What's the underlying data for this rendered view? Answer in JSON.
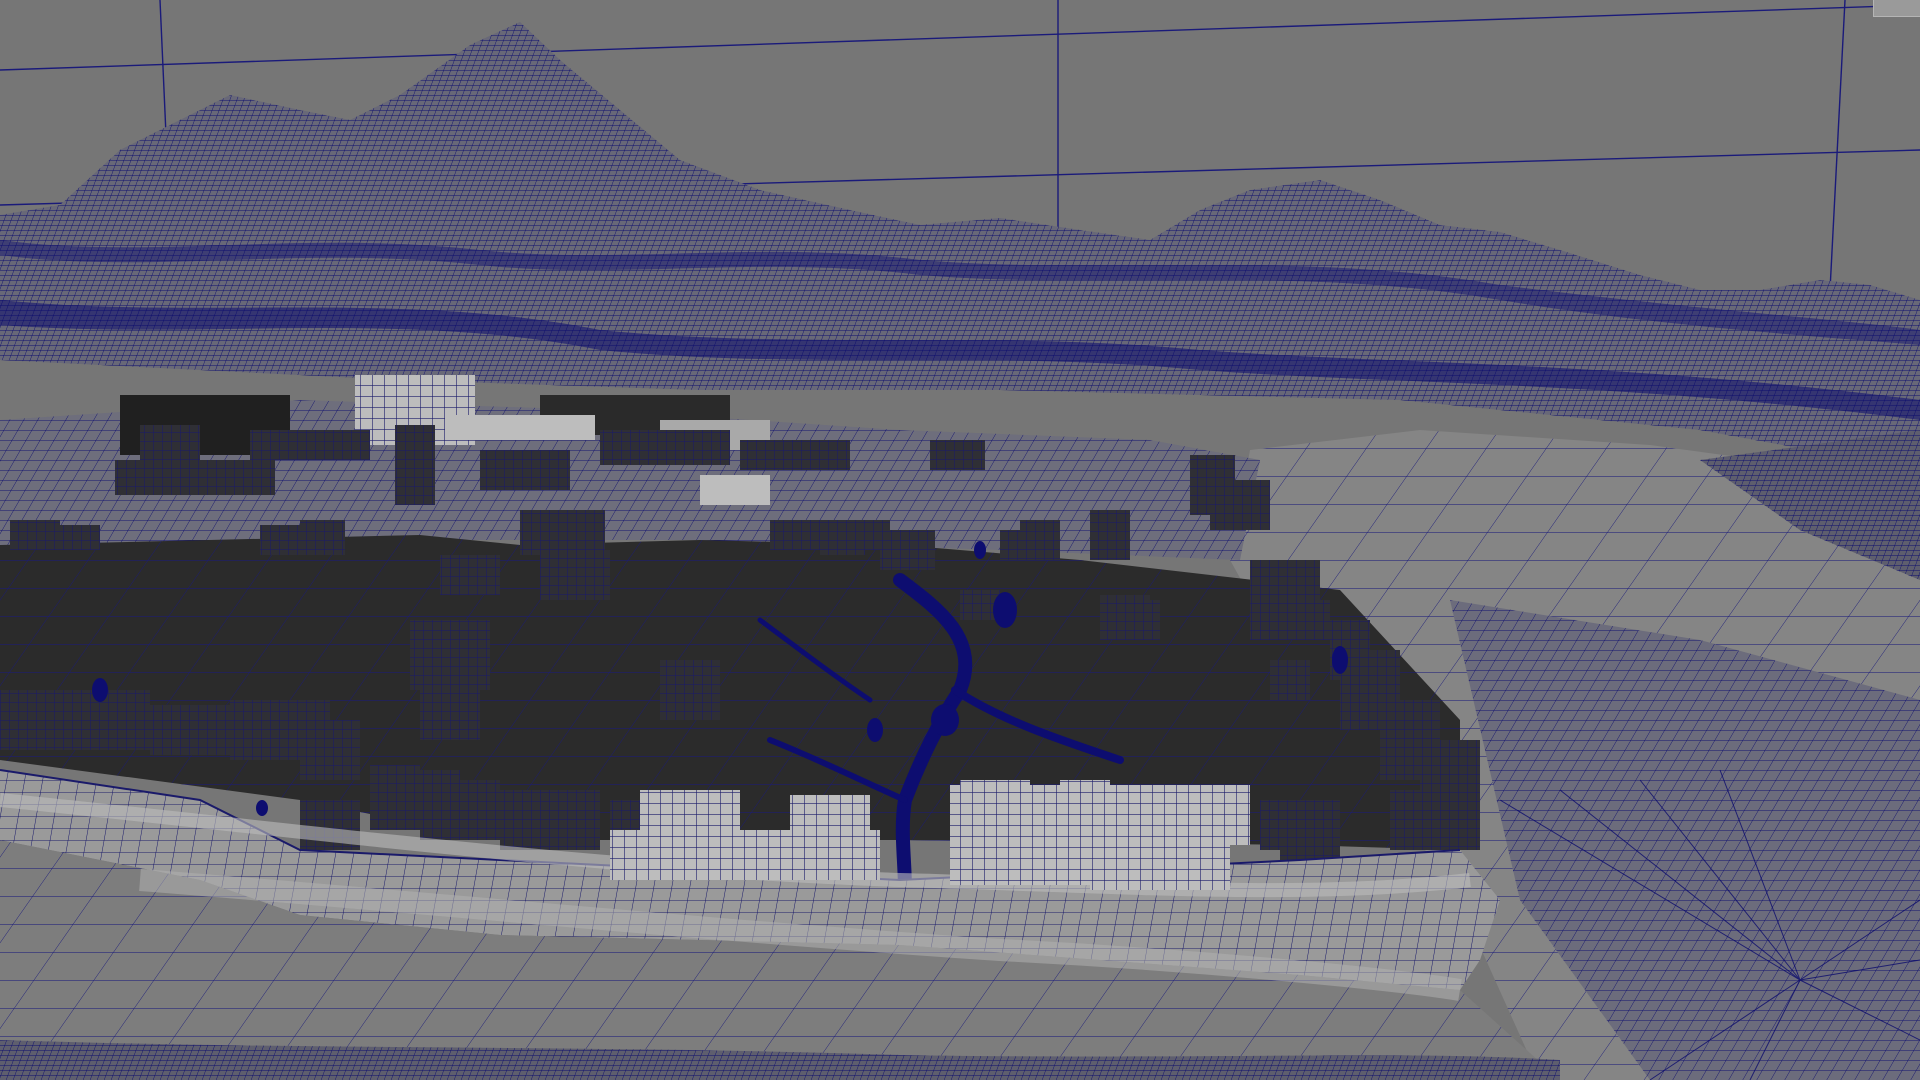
{
  "app": {
    "view": "perspective-viewport",
    "display_mode": "wireframe-on-shaded"
  },
  "colors": {
    "background": "#767676",
    "grid_line": "#1a1a7a",
    "wire": "#0b0b6e",
    "wire_dense": "#0a0a66",
    "terrain_fill": "#5e5e6e",
    "dark_ground": "#2b2b2b",
    "flat_plane": "#7d7d7d",
    "light_plane": "#9c9c9c",
    "building_light": "#bdbdbd",
    "building_dark": "#303030"
  },
  "scene_objects": [
    {
      "name": "mountain-range-mesh"
    },
    {
      "name": "town-block-meshes"
    },
    {
      "name": "tree-card-meshes"
    },
    {
      "name": "valley-ground-plane"
    },
    {
      "name": "river-mesh"
    },
    {
      "name": "cliff-edge-mesh"
    },
    {
      "name": "side-terrain-plane"
    }
  ]
}
